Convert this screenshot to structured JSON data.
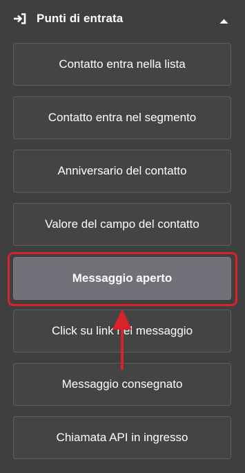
{
  "header": {
    "icon": "sign-in-icon",
    "title": "Punti di entrata",
    "collapse_icon": "caret-up-icon"
  },
  "items": [
    {
      "label": "Contatto entra nella lista"
    },
    {
      "label": "Contatto entra nel segmento"
    },
    {
      "label": "Anniversario del contatto"
    },
    {
      "label": "Valore del campo del contatto"
    },
    {
      "label": "Messaggio aperto",
      "selected": true
    },
    {
      "label": "Click su link nel messaggio"
    },
    {
      "label": "Messaggio consegnato"
    },
    {
      "label": "Chiamata API in ingresso"
    }
  ],
  "annotation": {
    "highlight_color": "#d8232a",
    "arrow_icon": "arrow-up-icon"
  }
}
